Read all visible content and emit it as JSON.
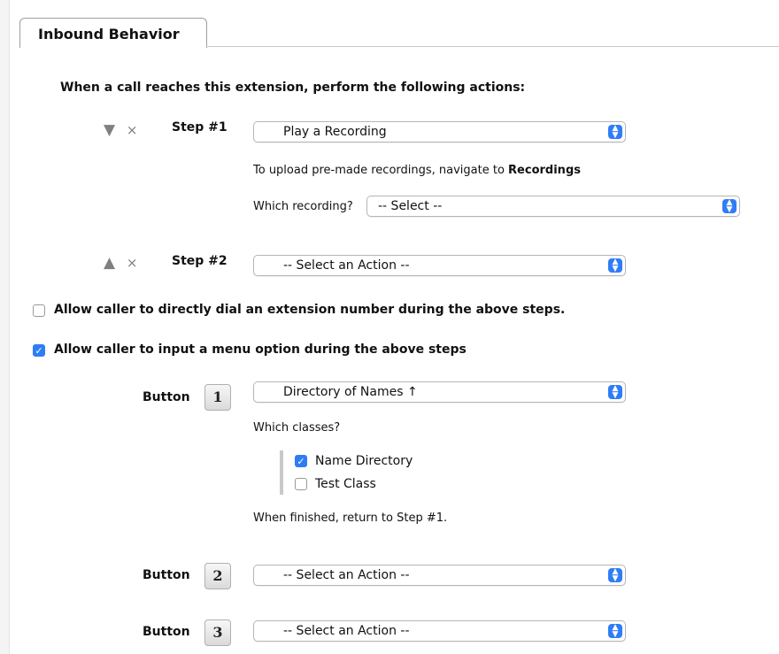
{
  "tab": {
    "title": "Inbound Behavior"
  },
  "heading": "When a call reaches this extension, perform the following actions:",
  "steps": [
    {
      "label": "Step #1",
      "move_icon": "▼",
      "remove_icon": "×",
      "action": "Play a Recording",
      "upload_note_prefix": "To upload pre-made recordings, navigate to ",
      "upload_note_link": "Recordings",
      "recording_label": "Which recording?",
      "recording_value": "-- Select --"
    },
    {
      "label": "Step #2",
      "move_icon": "▲",
      "remove_icon": "×",
      "action": "-- Select an Action --"
    }
  ],
  "options": {
    "dial_extension": {
      "label": "Allow caller to directly dial an extension number during the above steps.",
      "checked": false
    },
    "menu_option": {
      "label": "Allow caller to input a menu option during the above steps",
      "checked": true
    }
  },
  "buttons": [
    {
      "label": "Button",
      "number": "1",
      "action": "Directory of Names ↑",
      "classes_label": "Which classes?",
      "classes": [
        {
          "label": "Name Directory",
          "checked": true
        },
        {
          "label": "Test Class",
          "checked": false
        }
      ],
      "finish_note": "When finished, return to Step #1."
    },
    {
      "label": "Button",
      "number": "2",
      "action": "-- Select an Action --"
    },
    {
      "label": "Button",
      "number": "3",
      "action": "-- Select an Action --"
    }
  ],
  "colors": {
    "accent": "#2f7df6"
  }
}
